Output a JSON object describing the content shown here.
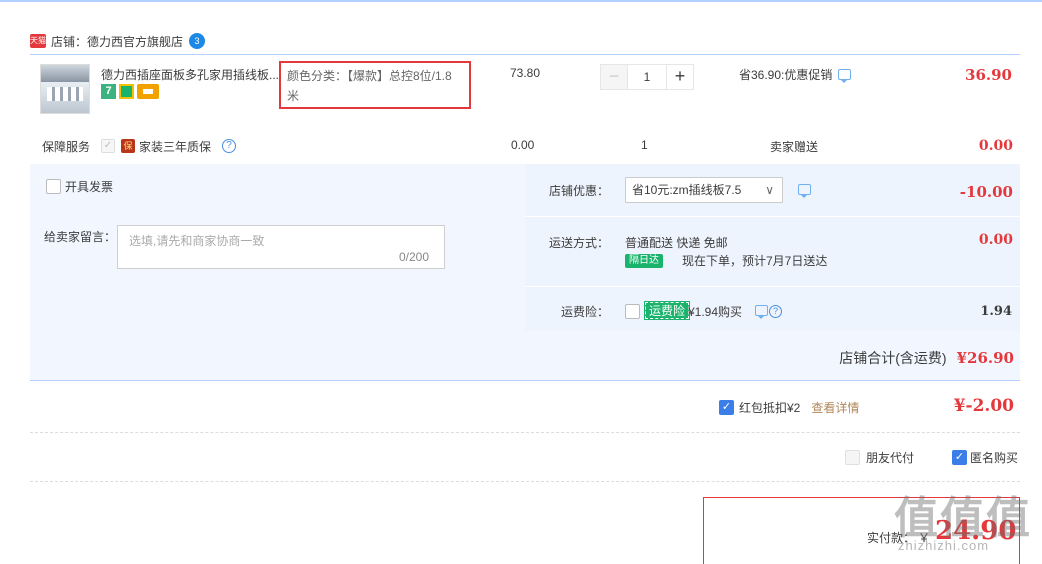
{
  "shop": {
    "badge": "天猫",
    "label": "店铺：德力西官方旗舰店",
    "ww_badge": "3"
  },
  "item": {
    "title": "德力西插座面板多孔家用插线板...",
    "tag_7": "7",
    "sku": "颜色分类：【爆款】总控8位/1.8米",
    "unit_price": "73.80",
    "qty_minus": "−",
    "qty_value": "1",
    "qty_plus": "+",
    "discount": "省36.90:优惠促销",
    "subtotal": "36.90"
  },
  "service": {
    "label": "保障服务",
    "badge": "保",
    "text": "家装三年质保",
    "help": "?",
    "price": "0.00",
    "qty": "1",
    "gift": "卖家赠送",
    "subtotal": "0.00"
  },
  "invoice": {
    "label": "开具发票"
  },
  "memo": {
    "label": "给卖家留言：",
    "placeholder": "选填,请先和商家协商一致",
    "count": "0/200"
  },
  "coupon": {
    "label": "店铺优惠：",
    "selected": "省10元:zm插线板7.5",
    "arrow": "∨",
    "amount": "-10.00"
  },
  "shipping": {
    "label": "运送方式：",
    "method": "普通配送 快递 免邮",
    "badge": "隔日达",
    "note": "现在下单，预计7月7日送达",
    "amount": "0.00"
  },
  "insurance": {
    "label": "运费险：",
    "badge": "运费险",
    "text": "¥1.94购买",
    "amount": "1.94"
  },
  "shop_total": {
    "label": "店铺合计(含运费)",
    "value": "¥26.90"
  },
  "red_packet": {
    "label": "红包抵扣¥2",
    "detail": "查看详情",
    "amount": "¥-2.00"
  },
  "options": {
    "friend_pay": "朋友代付",
    "anonymous": "匿名购买"
  },
  "payment": {
    "label": "实付款：",
    "currency": "￥",
    "amount": "24.90"
  },
  "watermark": {
    "main": "值值值",
    "sub": "zhizhizhi.com"
  },
  "colors": {
    "accent": "#e4393c",
    "border_blue": "#b2d1ff",
    "panel_bg": "#f2f7ff"
  }
}
